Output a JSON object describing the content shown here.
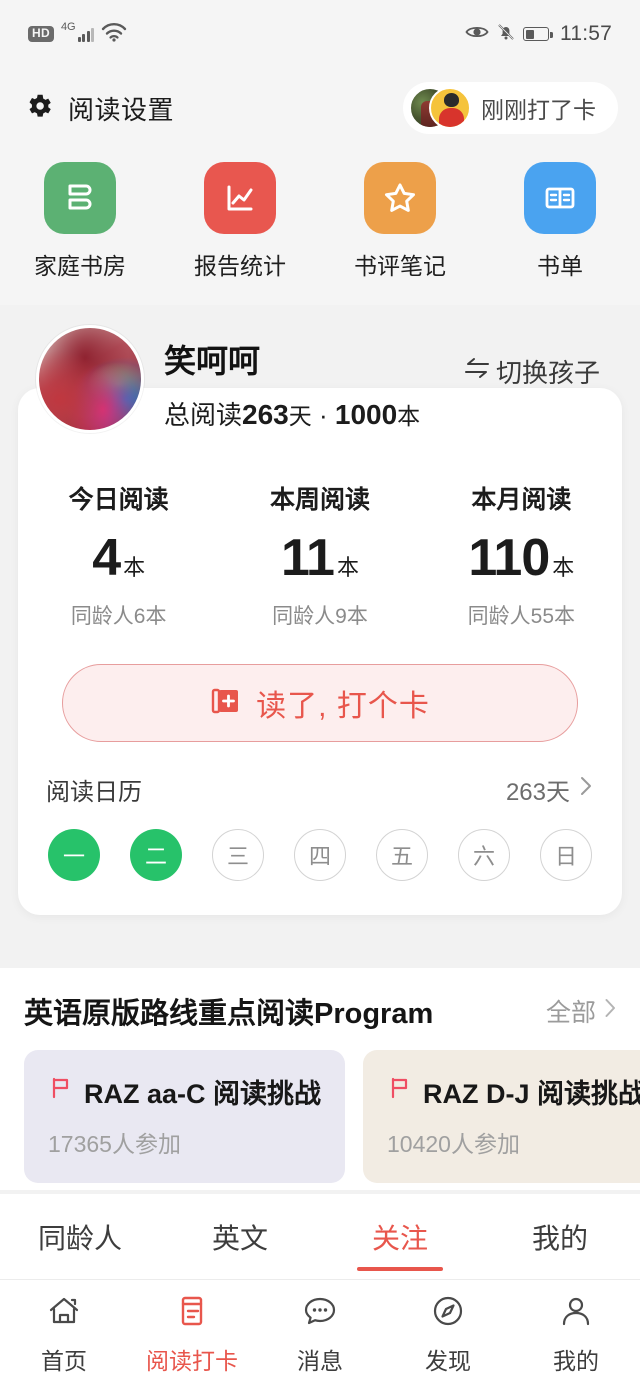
{
  "statusbar": {
    "hd_badge": "HD",
    "network": "4G",
    "time": "11:57",
    "icons": [
      "hd-icon",
      "signal-icon",
      "wifi-icon",
      "eye-comfort-icon",
      "mute-bell-icon",
      "battery-icon"
    ]
  },
  "header": {
    "title": "阅读设置",
    "gear_icon": "gear-icon",
    "checkin_pill_text": "刚刚打了卡"
  },
  "quick_actions": [
    {
      "label": "家庭书房",
      "icon": "bookshelf-icon",
      "color": "#5cb173"
    },
    {
      "label": "报告统计",
      "icon": "chart-report-icon",
      "color": "#e8574f"
    },
    {
      "label": "书评笔记",
      "icon": "star-icon",
      "color": "#eda04a"
    },
    {
      "label": "书单",
      "icon": "open-book-icon",
      "color": "#4aa3f0"
    }
  ],
  "profile": {
    "nickname": "笑呵呵",
    "total_prefix": "总阅读",
    "total_days": "263",
    "total_days_unit": "天",
    "separator": "·",
    "total_books": "1000",
    "total_books_unit": "本",
    "switch_child_label": "切换孩子",
    "switch_child_icon": "swap-arrows-icon"
  },
  "stats": [
    {
      "title": "今日阅读",
      "value": "4",
      "unit": "本",
      "peer": "同龄人6本"
    },
    {
      "title": "本周阅读",
      "value": "11",
      "unit": "本",
      "peer": "同龄人9本"
    },
    {
      "title": "本月阅读",
      "value": "110",
      "unit": "本",
      "peer": "同龄人55本"
    }
  ],
  "checkin_button": {
    "label": "读了, 打个卡",
    "icon": "book-plus-icon",
    "color": "#e8564c",
    "background": "#fdeeee"
  },
  "calendar": {
    "title": "阅读日历",
    "streak": "263天",
    "chevron_icon": "chevron-right-icon",
    "days": [
      {
        "label": "一",
        "checked": true
      },
      {
        "label": "二",
        "checked": true
      },
      {
        "label": "三",
        "checked": false
      },
      {
        "label": "四",
        "checked": false
      },
      {
        "label": "五",
        "checked": false
      },
      {
        "label": "六",
        "checked": false
      },
      {
        "label": "日",
        "checked": false
      }
    ],
    "checked_color": "#27c26a"
  },
  "program": {
    "title": "英语原版路线重点阅读Program",
    "all_label": "全部",
    "chevron_icon": "chevron-right-icon",
    "cards": [
      {
        "title": "RAZ aa-C 阅读挑战",
        "sub": "17365人参加",
        "bg": "#e9e8f2",
        "flag_icon": "flag-icon"
      },
      {
        "title": "RAZ D-J 阅读挑战",
        "sub": "10420人参加",
        "bg": "#f2ece3",
        "flag_icon": "flag-icon"
      }
    ]
  },
  "tabs": [
    {
      "label": "同龄人",
      "active": false
    },
    {
      "label": "英文",
      "active": false
    },
    {
      "label": "关注",
      "active": true
    },
    {
      "label": "我的",
      "active": false
    }
  ],
  "bottom_nav": [
    {
      "label": "首页",
      "icon": "home-icon",
      "active": false
    },
    {
      "label": "阅读打卡",
      "icon": "document-checkin-icon",
      "active": true
    },
    {
      "label": "消息",
      "icon": "chat-bubble-icon",
      "active": false
    },
    {
      "label": "发现",
      "icon": "compass-icon",
      "active": false
    },
    {
      "label": "我的",
      "icon": "person-icon",
      "active": false
    }
  ],
  "theme": {
    "accent": "#e8564c",
    "green": "#27c26a",
    "page_bg": "#f2f2f2"
  }
}
